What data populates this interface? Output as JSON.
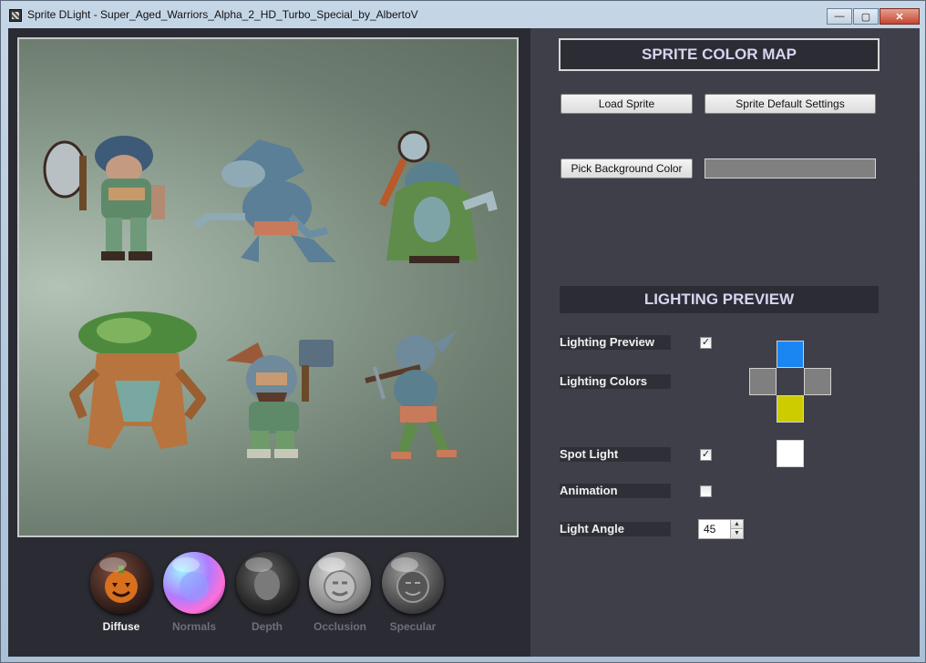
{
  "window": {
    "title": "Sprite DLight - Super_Aged_Warriors_Alpha_2_HD_Turbo_Special_by_AlbertoV",
    "controls": {
      "minimize": "—",
      "maximize": "▢",
      "close": "✕"
    }
  },
  "preview": {
    "sprites": [
      "orc-axe-warrior",
      "werewolf",
      "green-robed-mage",
      "treant",
      "dwarf-hammer-warrior",
      "goblin-crossbow"
    ]
  },
  "map_buttons": [
    {
      "label": "Diffuse",
      "active": true
    },
    {
      "label": "Normals",
      "active": false
    },
    {
      "label": "Depth",
      "active": false
    },
    {
      "label": "Occlusion",
      "active": false
    },
    {
      "label": "Specular",
      "active": false
    }
  ],
  "panel": {
    "color_map_title": "SPRITE COLOR MAP",
    "load_sprite": "Load Sprite",
    "default_settings": "Sprite Default Settings",
    "pick_bg": "Pick Background Color",
    "bg_color": "#808080",
    "lighting_title": "LIGHTING PREVIEW",
    "lighting_preview_label": "Lighting Preview",
    "lighting_preview_checked": true,
    "lighting_colors_label": "Lighting Colors",
    "lighting_colors": {
      "top": "#1a86f2",
      "left": "#7f7f7f",
      "right": "#7f7f7f",
      "bottom": "#cccc00"
    },
    "spot_light_label": "Spot Light",
    "spot_light_checked": true,
    "spot_light_color": "#ffffff",
    "animation_label": "Animation",
    "animation_checked": false,
    "light_angle_label": "Light Angle",
    "light_angle_value": "45"
  },
  "icons": {
    "check": "✓",
    "spin_up": "▲",
    "spin_down": "▼"
  }
}
